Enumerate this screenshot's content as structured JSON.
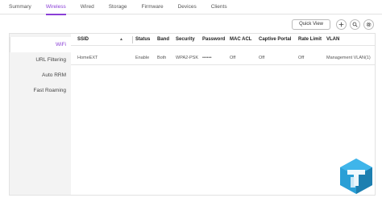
{
  "tabs": [
    "Summary",
    "Wireless",
    "Wired",
    "Storage",
    "Firmware",
    "Devices",
    "Clients"
  ],
  "active_tab": "Wireless",
  "toolbar": {
    "quick_view": "Quick View"
  },
  "sidebar": {
    "items": [
      {
        "label": "WiFi",
        "active": true
      },
      {
        "label": "URL Filtering",
        "active": false
      },
      {
        "label": "Auto RRM",
        "active": false
      },
      {
        "label": "Fast Roaming",
        "active": false
      }
    ]
  },
  "table": {
    "headers": [
      "SSID",
      "Status",
      "Band",
      "Security",
      "Password",
      "MAC ACL",
      "Captive Portal",
      "Rate Limit",
      "VLAN"
    ],
    "sort_indicator": "▲",
    "rows": [
      [
        "HomeEXT",
        "Enable",
        "Both",
        "WPA2-PSK",
        "••••••",
        "Off",
        "Off",
        "Off",
        "Management VLAN(1)"
      ]
    ]
  },
  "colors": {
    "accent": "#8a3fd6",
    "logo": "#2a9fd6"
  },
  "icons": [
    "plus-icon",
    "search-icon",
    "settings-icon"
  ]
}
